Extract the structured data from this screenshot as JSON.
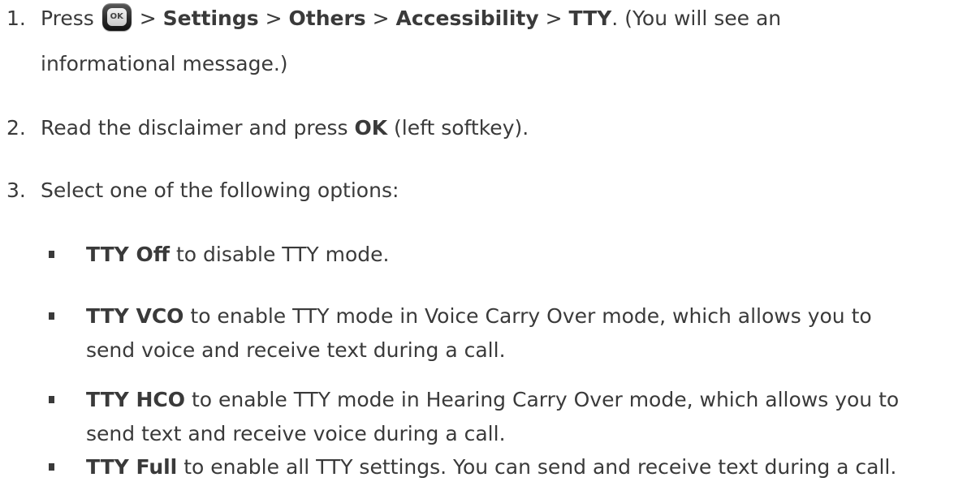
{
  "steps": [
    {
      "number": "1.",
      "press": "Press",
      "ok_key_label": "OK",
      "sep": ">",
      "path": [
        "Settings",
        "Others",
        "Accessibility",
        "TTY"
      ],
      "after": ". (You will see an",
      "line2": "informational message.)"
    },
    {
      "number": "2.",
      "text_before": "Read the disclaimer and press",
      "bold": "OK",
      "text_after": "(left softkey)."
    },
    {
      "number": "3.",
      "text": "Select one of the following options:"
    }
  ],
  "options": [
    {
      "label": "TTY Off",
      "line1": "to disable TTY mode.",
      "line2": ""
    },
    {
      "label": "TTY VCO",
      "line1": "to enable TTY mode in Voice Carry Over mode, which allows you to",
      "line2": "send voice and receive text during a call."
    },
    {
      "label": "TTY HCO",
      "line1": "to enable TTY mode in Hearing Carry Over mode, which allows you to",
      "line2": "send text and receive voice during a call."
    },
    {
      "label": "TTY Full",
      "line1": "to enable all TTY settings. You can send and receive text during a call.",
      "line2": ""
    }
  ]
}
